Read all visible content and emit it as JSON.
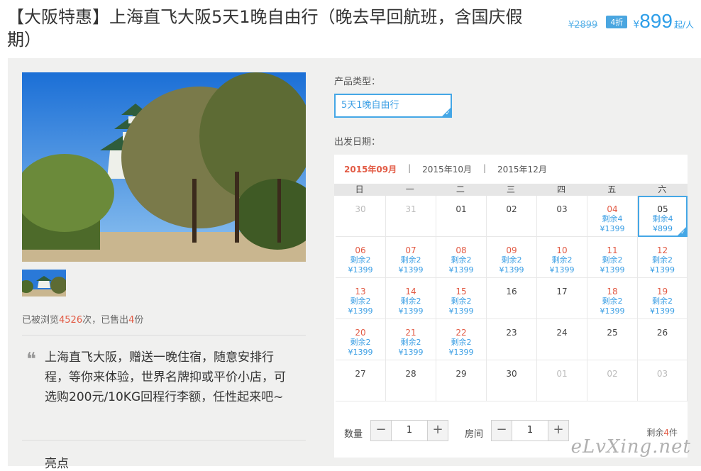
{
  "product": {
    "title": "【大阪特惠】上海直飞大阪5天1晚自由行（晚去早回航班，含国庆假期）",
    "old_price": "¥2899",
    "discount": "4折",
    "currency": "¥",
    "price": "899",
    "price_unit": "起/人"
  },
  "gallery": {
    "main_image": "osaka-castle-photo",
    "thumbnail": "osaka-castle-thumbnail"
  },
  "stats": {
    "prefix": "已被浏览",
    "views": "4526",
    "mid": "次，已售出",
    "sold": "4",
    "suffix": "份"
  },
  "description": "上海直飞大阪，赠送一晚住宿，随意安排行程，等你来体验，世界名牌抑或平价小店，可选购200元/10KG回程行李额，任性起来吧~",
  "highlight_heading": "亮点",
  "options": {
    "type_label": "产品类型：",
    "type_value": "5天1晚自由行",
    "date_label": "出发日期："
  },
  "calendar": {
    "months": [
      "2015年09月",
      "2015年10月",
      "2015年12月"
    ],
    "active_month": "2015年09月",
    "weekdays": [
      "日",
      "一",
      "二",
      "三",
      "四",
      "五",
      "六"
    ],
    "days": [
      {
        "d": "30",
        "state": "dim"
      },
      {
        "d": "31",
        "state": "dim"
      },
      {
        "d": "01",
        "state": "norm"
      },
      {
        "d": "02",
        "state": "norm"
      },
      {
        "d": "03",
        "state": "norm"
      },
      {
        "d": "04",
        "state": "avail",
        "r": "剩余4",
        "p": "¥1399"
      },
      {
        "d": "05",
        "state": "sel",
        "r": "剩余4",
        "p": "¥899"
      },
      {
        "d": "06",
        "state": "avail",
        "r": "剩余2",
        "p": "¥1399"
      },
      {
        "d": "07",
        "state": "avail",
        "r": "剩余2",
        "p": "¥1399"
      },
      {
        "d": "08",
        "state": "avail",
        "r": "剩余2",
        "p": "¥1399"
      },
      {
        "d": "09",
        "state": "avail",
        "r": "剩余2",
        "p": "¥1399"
      },
      {
        "d": "10",
        "state": "avail",
        "r": "剩余2",
        "p": "¥1399"
      },
      {
        "d": "11",
        "state": "avail",
        "r": "剩余2",
        "p": "¥1399"
      },
      {
        "d": "12",
        "state": "avail",
        "r": "剩余2",
        "p": "¥1399"
      },
      {
        "d": "13",
        "state": "avail",
        "r": "剩余2",
        "p": "¥1399"
      },
      {
        "d": "14",
        "state": "avail",
        "r": "剩余2",
        "p": "¥1399"
      },
      {
        "d": "15",
        "state": "avail",
        "r": "剩余2",
        "p": "¥1399"
      },
      {
        "d": "16",
        "state": "norm"
      },
      {
        "d": "17",
        "state": "norm"
      },
      {
        "d": "18",
        "state": "avail",
        "r": "剩余2",
        "p": "¥1399"
      },
      {
        "d": "19",
        "state": "avail",
        "r": "剩余2",
        "p": "¥1399"
      },
      {
        "d": "20",
        "state": "avail",
        "r": "剩余2",
        "p": "¥1399"
      },
      {
        "d": "21",
        "state": "avail",
        "r": "剩余2",
        "p": "¥1399"
      },
      {
        "d": "22",
        "state": "avail",
        "r": "剩余2",
        "p": "¥1399"
      },
      {
        "d": "23",
        "state": "norm"
      },
      {
        "d": "24",
        "state": "norm"
      },
      {
        "d": "25",
        "state": "norm"
      },
      {
        "d": "26",
        "state": "norm"
      },
      {
        "d": "27",
        "state": "norm"
      },
      {
        "d": "28",
        "state": "norm"
      },
      {
        "d": "29",
        "state": "norm"
      },
      {
        "d": "30",
        "state": "norm"
      },
      {
        "d": "01",
        "state": "dim"
      },
      {
        "d": "02",
        "state": "dim"
      },
      {
        "d": "03",
        "state": "dim"
      }
    ]
  },
  "booking": {
    "qty_label": "数量",
    "qty_value": "1",
    "room_label": "房间",
    "room_value": "1",
    "minus": "−",
    "plus": "+",
    "remain_prefix": "剩余",
    "remain_num": "4",
    "remain_suffix": "件"
  },
  "watermark": "eLvXing.net",
  "colors": {
    "accent_blue": "#45a7e6",
    "accent_red": "#e25b45",
    "panel_bg": "#f0f0ef"
  }
}
